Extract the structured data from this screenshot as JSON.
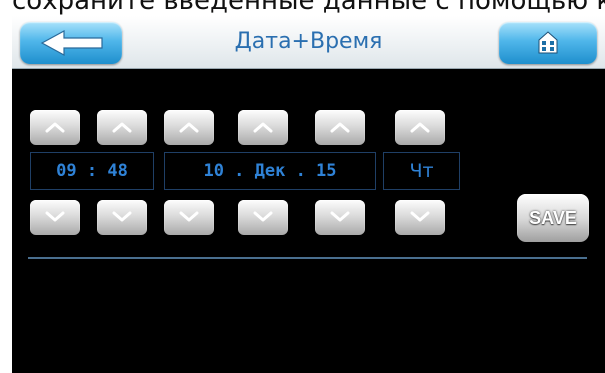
{
  "caption": "сохраните введенные данные с помощью к",
  "header": {
    "title": "Дата+Время",
    "back_icon": "arrow-left-icon",
    "home_icon": "home-icon"
  },
  "time": "09 : 48",
  "date": "10 . Дек . 15",
  "weekday": "Чт",
  "save_label": "SAVE",
  "colors": {
    "header_bg": "#ffffff",
    "accent_blue": "#2f82d6",
    "button_blue": "#1f8fcd",
    "screen_bg": "#000000"
  }
}
